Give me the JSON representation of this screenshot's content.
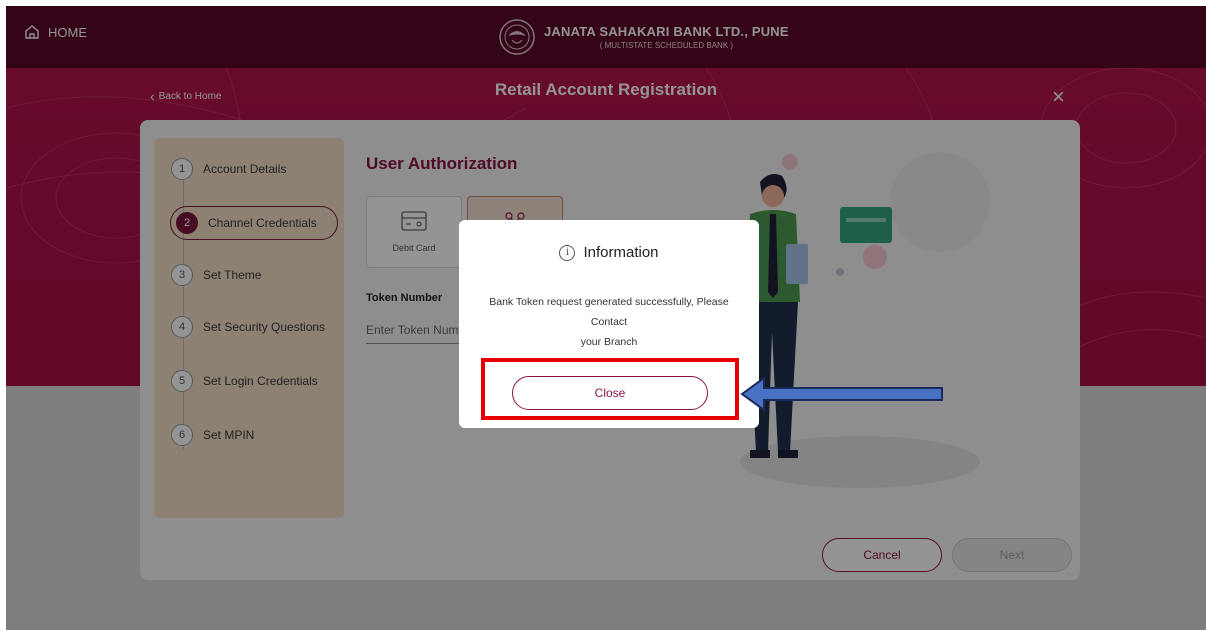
{
  "header": {
    "home_label": "HOME",
    "bank_name": "JANATA SAHAKARI BANK LTD., PUNE",
    "bank_subtitle": "( MULTISTATE SCHEDULED BANK )"
  },
  "nav": {
    "back_label": "Back to Home",
    "page_title": "Retail Account Registration"
  },
  "steps": [
    {
      "num": "1",
      "label": "Account Details"
    },
    {
      "num": "2",
      "label": "Channel Credentials",
      "active": true
    },
    {
      "num": "3",
      "label": "Set Theme"
    },
    {
      "num": "4",
      "label": "Set Security Questions"
    },
    {
      "num": "5",
      "label": "Set Login Credentials"
    },
    {
      "num": "6",
      "label": "Set MPIN"
    }
  ],
  "auth": {
    "title": "User Authorization",
    "debit_card_label": "Debit Card",
    "token_label": "Token Number",
    "token_placeholder": "Enter Token Number"
  },
  "footer": {
    "cancel_label": "Cancel",
    "next_label": "Next"
  },
  "modal": {
    "title": "Information",
    "message_line1": "Bank Token request generated successfully, Please Contact",
    "message_line2": "your Branch",
    "close_label": "Close"
  },
  "colors": {
    "topbar": "#5a0a2a",
    "hero": "#b2134f",
    "accent": "#8a1347",
    "stepper_bg": "#f1dfc7",
    "highlight": "#e60000",
    "arrow": "#4a72c4"
  }
}
